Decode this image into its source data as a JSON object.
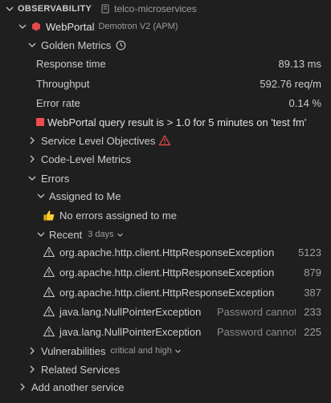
{
  "header": {
    "title": "OBSERVABILITY",
    "repo": "telco-microservices"
  },
  "entity": {
    "name": "WebPortal",
    "account": "Demotron V2 (APM)"
  },
  "golden_metrics": {
    "label": "Golden Metrics",
    "metrics": [
      {
        "name": "Response time",
        "value": "89.13 ms"
      },
      {
        "name": "Throughput",
        "value": "592.76 req/m"
      },
      {
        "name": "Error rate",
        "value": "0.14 %"
      }
    ],
    "alert": "WebPortal query result is > 1.0 for 5 minutes on 'test fm'"
  },
  "service_level_objectives": "Service Level Objectives",
  "code_level_metrics": "Code-Level Metrics",
  "errors": {
    "label": "Errors",
    "assigned": {
      "label": "Assigned to Me",
      "empty": "No errors assigned to me"
    },
    "recent": {
      "label": "Recent",
      "range": "3 days",
      "items": [
        {
          "name": "org.apache.http.client.HttpResponseException",
          "message": "",
          "count": "5123"
        },
        {
          "name": "org.apache.http.client.HttpResponseException",
          "message": "",
          "count": "879"
        },
        {
          "name": "org.apache.http.client.HttpResponseException",
          "message": "",
          "count": "387"
        },
        {
          "name": "java.lang.NullPointerException",
          "message": "Password cannot",
          "count": "233"
        },
        {
          "name": "java.lang.NullPointerException",
          "message": "Password cannot",
          "count": "225"
        }
      ]
    }
  },
  "vulnerabilities": {
    "label": "Vulnerabilities",
    "filter": "critical and high"
  },
  "related_services": "Related Services",
  "add_service": "Add another service",
  "colors": {
    "background": "#1f1f1f",
    "entity_red": "#e5484d",
    "alert_red": "#f14c4c",
    "warning_red": "#f14c4c"
  }
}
